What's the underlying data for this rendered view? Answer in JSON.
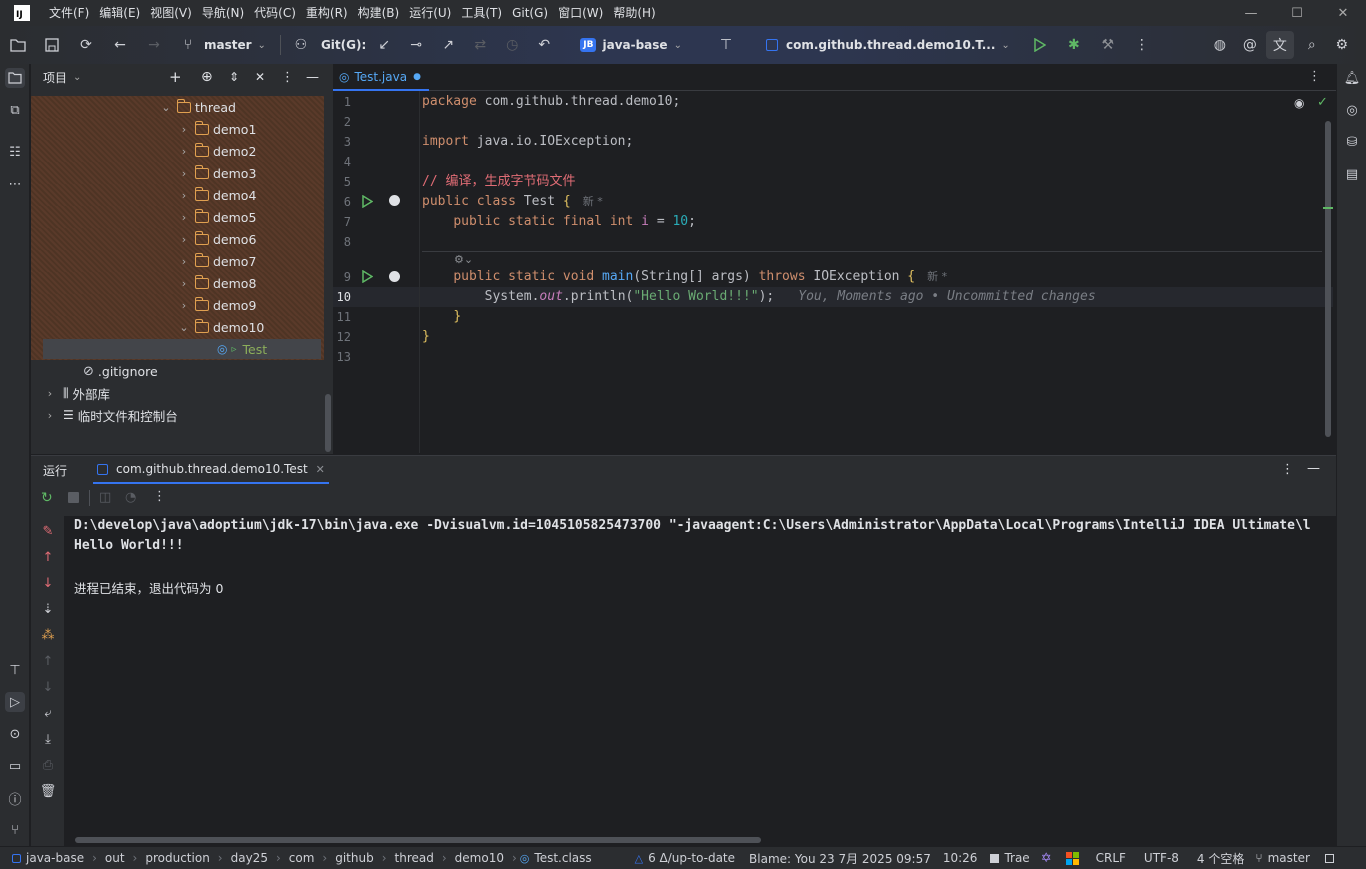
{
  "menubar": {
    "items": [
      "文件(F)",
      "编辑(E)",
      "视图(V)",
      "导航(N)",
      "代码(C)",
      "重构(R)",
      "构建(B)",
      "运行(U)",
      "工具(T)",
      "Git(G)",
      "窗口(W)",
      "帮助(H)"
    ]
  },
  "toolbar": {
    "branch": "master",
    "git_label": "Git(G):",
    "project_badge": "JB",
    "project_name": "java-base",
    "run_config": "com.github.thread.demo10.T..."
  },
  "project": {
    "title": "项目",
    "tree": [
      {
        "label": "thread",
        "type": "folder",
        "expanded": true
      },
      {
        "label": "demo1",
        "type": "folder"
      },
      {
        "label": "demo2",
        "type": "folder"
      },
      {
        "label": "demo3",
        "type": "folder"
      },
      {
        "label": "demo4",
        "type": "folder"
      },
      {
        "label": "demo5",
        "type": "folder"
      },
      {
        "label": "demo6",
        "type": "folder"
      },
      {
        "label": "demo7",
        "type": "folder"
      },
      {
        "label": "demo8",
        "type": "folder"
      },
      {
        "label": "demo9",
        "type": "folder"
      },
      {
        "label": "demo10",
        "type": "folder",
        "expanded": true
      },
      {
        "label": "Test",
        "type": "class",
        "selected": true
      },
      {
        "label": ".gitignore",
        "type": "file"
      },
      {
        "label": "外部库",
        "type": "library"
      },
      {
        "label": "临时文件和控制台",
        "type": "scratch"
      }
    ]
  },
  "editor": {
    "tab_label": "Test.java",
    "line_numbers": [
      "1",
      "2",
      "3",
      "4",
      "5",
      "6",
      "7",
      "8",
      "9",
      "10",
      "11",
      "12",
      "13"
    ],
    "code": {
      "l1_kw": "package",
      "l1_rest": " com.github.thread.demo10;",
      "l3_kw": "import",
      "l3_rest": " java.io.IOException;",
      "l5": "// 编译，生成字节码文件",
      "l6_kw": "public class",
      "l6_name": " Test ",
      "l6_brace": "{",
      "l6_hint": "新 *",
      "l7_kw": "public static final int",
      "l7_var": " i ",
      "l7_eq": "= ",
      "l7_num": "10",
      "l7_end": ";",
      "l9_kw": "public static void",
      "l9_fn": " main",
      "l9_params": "(String[] args) ",
      "l9_throws": "throws",
      "l9_exc": " IOException ",
      "l9_brace": "{",
      "l9_hint": "新 *",
      "l10_a": "System.",
      "l10_out": "out",
      "l10_b": ".println(",
      "l10_str": "\"Hello World!!!\"",
      "l10_c": ");",
      "l10_blame": "You, Moments ago • Uncommitted changes",
      "l11": "}",
      "l12": "}"
    }
  },
  "run": {
    "label": "运行",
    "tab_label": "com.github.thread.demo10.Test",
    "console": [
      "D:\\develop\\java\\adoptium\\jdk-17\\bin\\java.exe -Dvisualvm.id=1045105825473700 \"-javaagent:C:\\Users\\Administrator\\AppData\\Local\\Programs\\IntelliJ IDEA Ultimate\\l",
      "Hello World!!!",
      "",
      "进程已结束，退出代码为 0"
    ]
  },
  "statusbar": {
    "breadcrumbs": [
      "java-base",
      "out",
      "production",
      "day25",
      "com",
      "github",
      "thread",
      "demo10",
      "Test.class"
    ],
    "git_status": "6 Δ/up-to-date",
    "blame": "Blame: You 23 7月 2025 09:57",
    "position": "10:26",
    "trae": "Trae",
    "line_ending": "CRLF",
    "encoding": "UTF-8",
    "indent": "4 个空格",
    "branch": "master"
  },
  "colors": {
    "accent": "#3574f0",
    "run_green": "#5fb865",
    "folder": "#e0a050"
  }
}
